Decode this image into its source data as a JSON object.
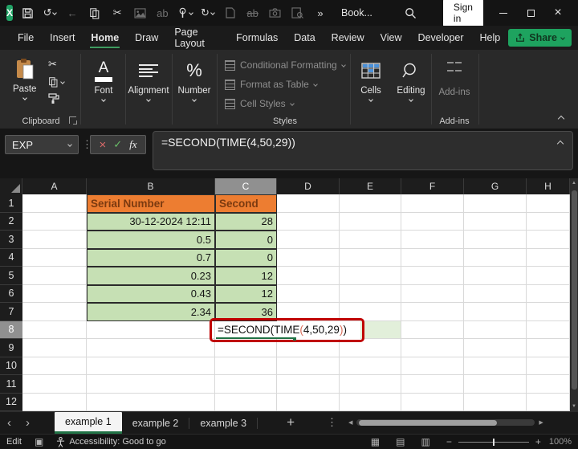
{
  "window": {
    "app_logo": "X",
    "doc_title": "Book...",
    "sign_in": "Sign in"
  },
  "icons": {
    "undo": "↺",
    "redo": "↻",
    "back": "←",
    "cut": "✂",
    "more": "»",
    "dots": "⋮",
    "cancel": "×",
    "accept": "✓",
    "close": "×",
    "scroll_up": "▲",
    "scroll_down": "▼",
    "scroll_left": "◀",
    "scroll_right": "▶",
    "tab_prev": "‹",
    "tab_next": "›",
    "minus": "−",
    "plus": "+",
    "find_replace": "ab",
    "strike": "ab",
    "percent": "%",
    "font_a": "A",
    "view_normal": "▦",
    "view_layout": "▤",
    "view_break": "▥",
    "macro": "▣"
  },
  "menu": {
    "tabs": [
      "File",
      "Insert",
      "Home",
      "Draw",
      "Page Layout",
      "Formulas",
      "Data",
      "Review",
      "View",
      "Developer",
      "Help"
    ],
    "active_tab": "Home",
    "share": "Share"
  },
  "ribbon": {
    "paste": "Paste",
    "clipboard_group": "Clipboard",
    "font": "Font",
    "alignment": "Alignment",
    "number": "Number",
    "styles_items": [
      "Conditional Formatting",
      "Format as Table",
      "Cell Styles"
    ],
    "styles_group": "Styles",
    "cells": "Cells",
    "editing": "Editing",
    "addins": "Add-ins",
    "addins_group": "Add-ins"
  },
  "formula_bar": {
    "name_box": "EXP",
    "fx": "fx",
    "formula": "=SECOND(TIME(4,50,29))"
  },
  "grid": {
    "columns": [
      "A",
      "B",
      "C",
      "D",
      "E",
      "F",
      "G",
      "H"
    ],
    "rows": [
      "1",
      "2",
      "3",
      "4",
      "5",
      "6",
      "7",
      "8",
      "9",
      "10",
      "11",
      "12"
    ],
    "selected_column": "C",
    "selected_row": "8",
    "table": {
      "header_serial": "Serial Number",
      "header_second": "Second",
      "data": [
        {
          "serial": "30-12-2024 12:11",
          "second": "28"
        },
        {
          "serial": "0.5",
          "second": "0"
        },
        {
          "serial": "0.7",
          "second": "0"
        },
        {
          "serial": "0.23",
          "second": "12"
        },
        {
          "serial": "0.43",
          "second": "12"
        },
        {
          "serial": "2.34",
          "second": "36"
        }
      ]
    },
    "formula_cell": {
      "p1": "=SECOND(TIME",
      "p2": "(",
      "p3": "4,50,29",
      "p4": ")",
      "p5": ")"
    }
  },
  "sheet_bar": {
    "tabs": [
      "example 1",
      "example 2",
      "example 3"
    ],
    "active_tab": "example 1",
    "add": "+"
  },
  "status_bar": {
    "mode": "Edit",
    "accessibility": "Accessibility: Good to go",
    "zoom": "100%"
  },
  "colors": {
    "header_fill": "#ED7D31",
    "header_text": "#7B3A10",
    "data_fill": "#C6E0B4",
    "row8_fill": "#E2EFDA",
    "annotation_red": "#C00000",
    "paren_red": "#D86B57",
    "excel_green": "#21A366",
    "active_tab_underline": "#217346"
  }
}
